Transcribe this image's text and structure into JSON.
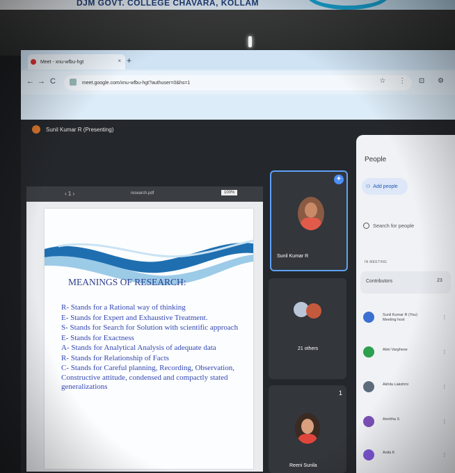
{
  "banner": {
    "text": "DJM GOVT. COLLEGE CHAVARA, KOLLAM"
  },
  "browser": {
    "tab_title": "Meet - xnu-wfbu-hgt",
    "new_tab": "+",
    "close": "×",
    "nav": {
      "back": "←",
      "forward": "→",
      "reload": "C"
    },
    "url": "meet.google.com/xnu-wfbu-hgt?authuser=0&hs=1",
    "extensions": "☆ ⋮ ⊡ ⚙"
  },
  "meet": {
    "presenter": "Sunil Kumar R (Presenting)",
    "viewer": {
      "nav": "‹ 1 ›",
      "file": "research.pdf",
      "zoom": "100%"
    },
    "slide": {
      "title": "MEANINGS OF RESEARCH:",
      "items": [
        "R- Stands for a Rational way of thinking",
        "E- Stands for Expert and Exhaustive Treatment.",
        "S- Stands for Search for Solution with scientific approach",
        "E- Stands for Exactness",
        "A- Stands for Analytical Analysis of adequate data",
        "R- Stands for Relationship of Facts",
        "C- Stands for Careful planning, Recording, Observation, Constructive attitude, condensed and compactly stated generalizations"
      ]
    },
    "tiles": [
      {
        "label": "Sunil Kumar R"
      },
      {
        "label": "21 others"
      },
      {
        "label": "Reeni Sunila"
      }
    ],
    "tile_badge": "1"
  },
  "people": {
    "title": "People",
    "add_label": "Add people",
    "search_placeholder": "Search for people",
    "section_label": "IN MEETING",
    "contributors_label": "Contributors",
    "contributors_count": "23",
    "list": [
      {
        "name": "Sunil Kumar R (You) Meeting host",
        "color": "#3b6fd1"
      },
      {
        "name": "Abin Varghese",
        "color": "#2e9e4f"
      },
      {
        "name": "Akhila Lakshmi",
        "color": "#5b6b7c"
      },
      {
        "name": "Amritha S",
        "color": "#7a4fb5"
      },
      {
        "name": "Anila K",
        "color": "#7d55d6"
      }
    ]
  }
}
